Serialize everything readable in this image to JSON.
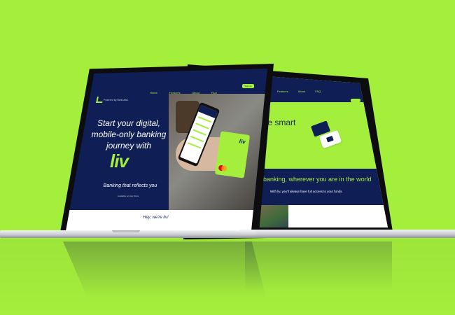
{
  "scene": {
    "background_color": "#a4ee3c",
    "brand_navy": "#0f1f56",
    "brand_lime": "#a4ee3c"
  },
  "front_screen": {
    "powered_by": "Powered by Bank ABC",
    "nav_items": [
      "Home",
      "Features",
      "About",
      "FAQ"
    ],
    "nav_button": "Sign up",
    "headline_lines": [
      "Start your digital,",
      "mobile-only banking",
      "journey with"
    ],
    "brand_mark": "liv",
    "tagline": "Banking that reflects you",
    "small_link": "Available on App Store",
    "card_logo": "liv",
    "section_title": "Hey, we're liv!"
  },
  "back_screen": {
    "nav_items": [
      "Features",
      "About",
      "FAQ"
    ],
    "hero_title": "y the smart",
    "band_title": "/7 banking, wherever you are in the world",
    "band_subtitle": "With liv, you'll always have full access to your funds."
  }
}
